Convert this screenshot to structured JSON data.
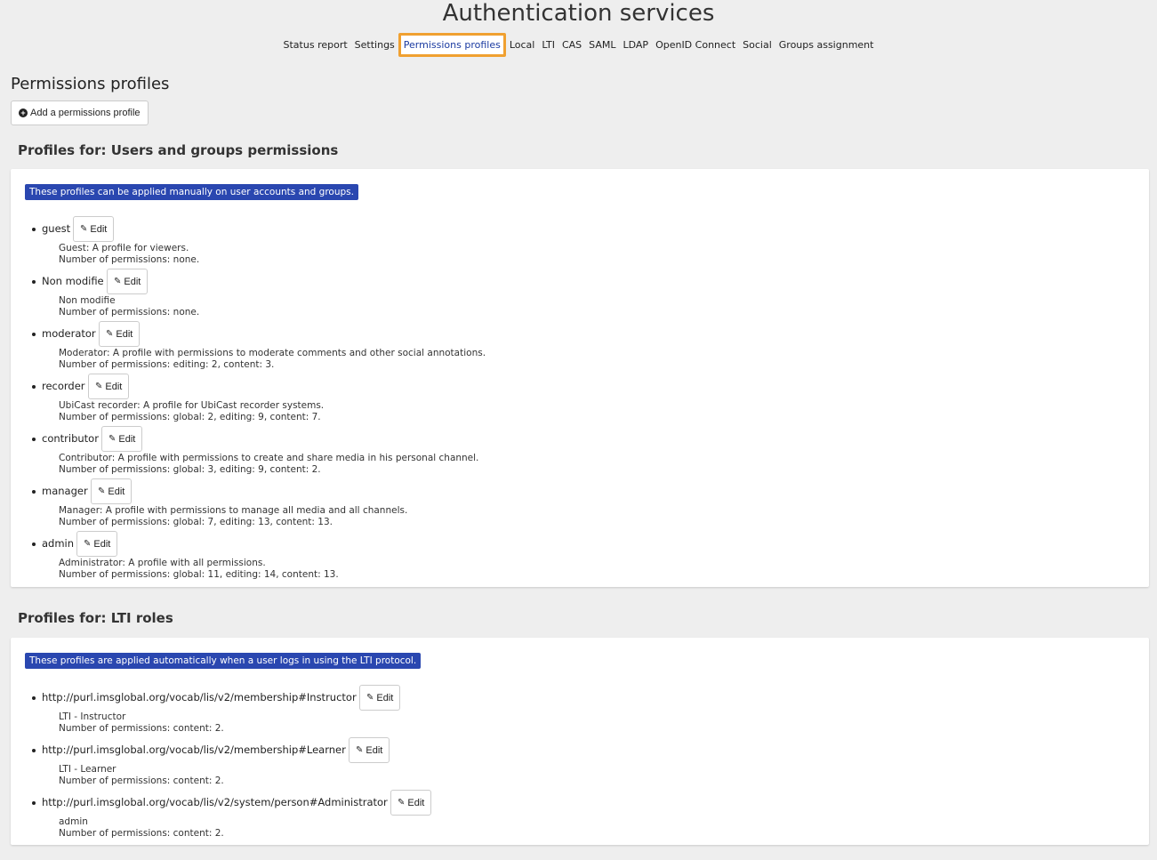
{
  "page": {
    "title": "Authentication services"
  },
  "tabs": [
    {
      "label": "Status report",
      "active": false
    },
    {
      "label": "Settings",
      "active": false
    },
    {
      "label": "Permissions profiles",
      "active": true
    },
    {
      "label": "Local",
      "active": false
    },
    {
      "label": "LTI",
      "active": false
    },
    {
      "label": "CAS",
      "active": false
    },
    {
      "label": "SAML",
      "active": false
    },
    {
      "label": "LDAP",
      "active": false
    },
    {
      "label": "OpenID Connect",
      "active": false
    },
    {
      "label": "Social",
      "active": false
    },
    {
      "label": "Groups assignment",
      "active": false
    }
  ],
  "section": {
    "title": "Permissions profiles",
    "add_label": "Add a permissions profile"
  },
  "edit_label": "Edit",
  "groups": [
    {
      "title": "Profiles for: Users and groups permissions",
      "notice": "These profiles can be applied manually on user accounts and groups.",
      "profiles": [
        {
          "name": "guest",
          "desc": "Guest: A profile for viewers.",
          "perms": "Number of permissions: none."
        },
        {
          "name": "Non modifie",
          "desc": "Non modifie",
          "perms": "Number of permissions: none."
        },
        {
          "name": "moderator",
          "desc": "Moderator: A profile with permissions to moderate comments and other social annotations.",
          "perms": "Number of permissions: editing: 2, content: 3."
        },
        {
          "name": "recorder",
          "desc": "UbiCast recorder: A profile for UbiCast recorder systems.",
          "perms": "Number of permissions: global: 2, editing: 9, content: 7."
        },
        {
          "name": "contributor",
          "desc": "Contributor: A profile with permissions to create and share media in his personal channel.",
          "perms": "Number of permissions: global: 3, editing: 9, content: 2."
        },
        {
          "name": "manager",
          "desc": "Manager: A profile with permissions to manage all media and all channels.",
          "perms": "Number of permissions: global: 7, editing: 13, content: 13."
        },
        {
          "name": "admin",
          "desc": "Administrator: A profile with all permissions.",
          "perms": "Number of permissions: global: 11, editing: 14, content: 13."
        }
      ]
    },
    {
      "title": "Profiles for: LTI roles",
      "notice": "These profiles are applied automatically when a user logs in using the LTI protocol.",
      "profiles": [
        {
          "name": "http://purl.imsglobal.org/vocab/lis/v2/membership#Instructor",
          "desc": "LTI - Instructor",
          "perms": "Number of permissions: content: 2."
        },
        {
          "name": "http://purl.imsglobal.org/vocab/lis/v2/membership#Learner",
          "desc": "LTI - Learner",
          "perms": "Number of permissions: content: 2."
        },
        {
          "name": "http://purl.imsglobal.org/vocab/lis/v2/system/person#Administrator",
          "desc": "admin",
          "perms": "Number of permissions: content: 2."
        }
      ]
    }
  ],
  "colors": {
    "accent": "#2a47b0",
    "active_tab_border": "#f0a030"
  }
}
